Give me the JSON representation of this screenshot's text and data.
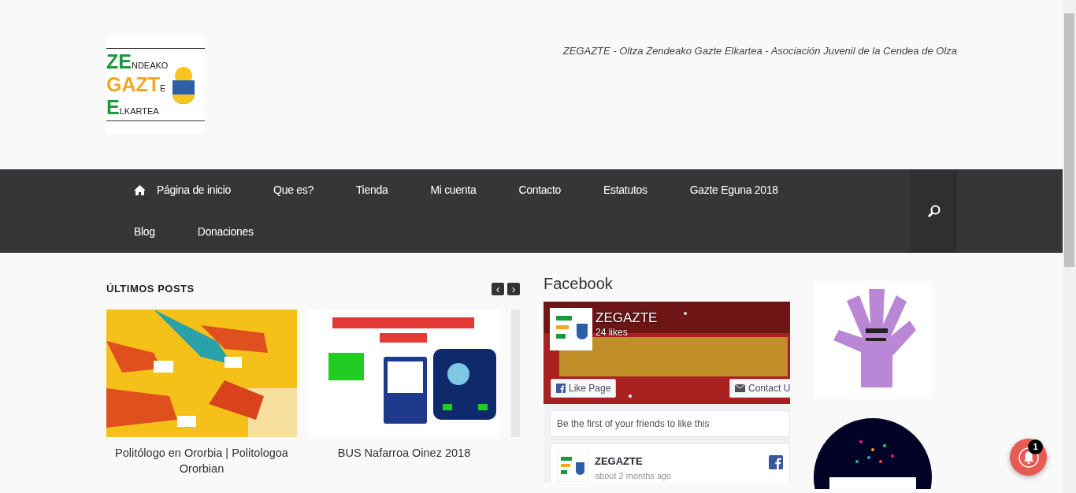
{
  "logo": {
    "lines": [
      {
        "big": "ZE",
        "small": "NDEAKO",
        "color": "#1a9a3c"
      },
      {
        "big": "GAZT",
        "small": "E",
        "color": "#f5a623"
      },
      {
        "big": "E",
        "small": "LKARTEA",
        "color": "#1a9a3c"
      }
    ]
  },
  "tagline": "ZEGAZTE - Oltza Zendeako Gazte Elkartea - Asociación Juvenil de la Cendea de Olza",
  "nav": {
    "items": [
      {
        "label": "Página de inicio"
      },
      {
        "label": "Que es?"
      },
      {
        "label": "Tienda"
      },
      {
        "label": "Mi cuenta"
      },
      {
        "label": "Contacto"
      },
      {
        "label": "Estatutos"
      },
      {
        "label": "Gazte Eguna 2018"
      },
      {
        "label": "Blog"
      },
      {
        "label": "Donaciones"
      }
    ]
  },
  "posts": {
    "title": "ÚLTIMOS POSTS",
    "prev": "‹",
    "next": "›",
    "items": [
      {
        "title": "Politólogo en Ororbia | Politologoa Ororbian",
        "kind": "hands"
      },
      {
        "title": "BUS Nafarroa Oinez 2018",
        "kind": "poster"
      }
    ]
  },
  "facebook": {
    "heading": "Facebook",
    "page_name": "ZEGAZTE",
    "likes": "24 likes",
    "like_button": "Like Page",
    "contact_button": "Contact U",
    "friends_text": "Be the first of your friends to like this",
    "post_author": "ZEGAZTE",
    "post_time": "about 2 months ago"
  },
  "notification": {
    "count": "1"
  }
}
